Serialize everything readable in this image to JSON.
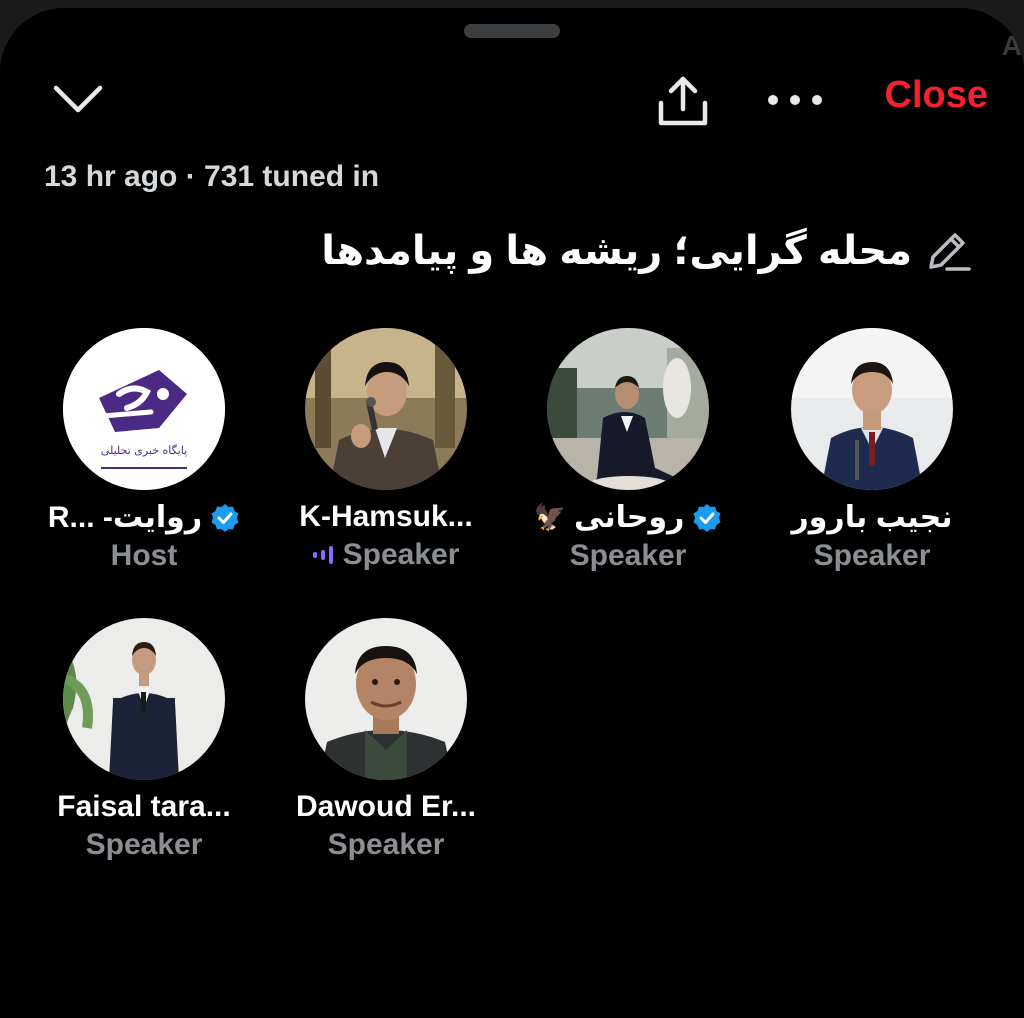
{
  "header": {
    "close_label": "Close",
    "icons": {
      "collapse": "chevron-down-icon",
      "share": "share-icon",
      "more": "more-icon"
    }
  },
  "space": {
    "meta": "13 hr ago · 731 tuned in",
    "title": "محله گرایی؛ ریشه ها و پیامدها",
    "edit_icon": "pencil-icon"
  },
  "participants": [
    {
      "name": "نجیب بارور",
      "role": "Speaker",
      "verified": false
    },
    {
      "name": "روحانی",
      "role": "Speaker",
      "verified": true,
      "emoji": "🦅"
    },
    {
      "name": "K-Hamsuk...",
      "role": "Speaker",
      "verified": false,
      "speaking": true
    },
    {
      "name": "R... -روایت",
      "role": "Host",
      "verified": true,
      "logo_text": "پایگاه خبری تحلیلی"
    },
    {
      "name": "Faisal tara...",
      "role": "Speaker",
      "verified": false
    },
    {
      "name": "Dawoud Er...",
      "role": "Speaker",
      "verified": false
    }
  ],
  "colors": {
    "background": "#000000",
    "close": "#f4212e",
    "verified": "#1d9bf0",
    "speaking_bars": "#8a6cff",
    "muted_text": "#8b8f94"
  }
}
